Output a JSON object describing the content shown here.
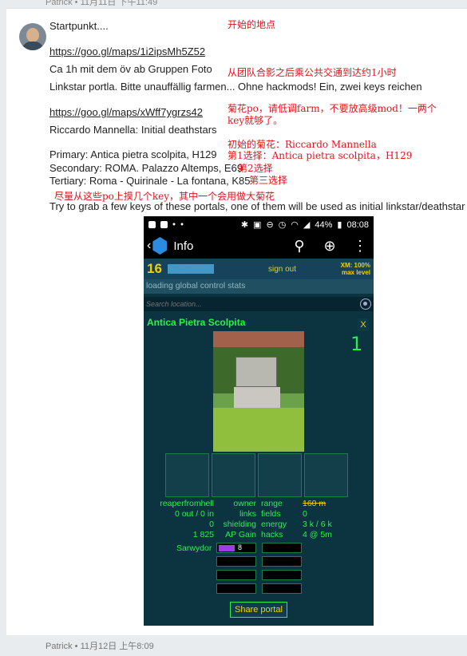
{
  "post": {
    "header_meta": "Patrick • 11月11日 下午11:49",
    "lines": [
      "Startpunkt....",
      "https://goo.gl/maps/1i2ipsMh5Z52",
      "Ca 1h mit dem öv ab Gruppen Foto",
      "Linkstar portla. Bitte unauffällig farmen... Ohne hackmods! Ein, zwei keys reichen",
      "https://goo.gl/maps/xWff7ygrzs42",
      "Riccardo Mannella: Initial deathstars",
      "Primary: Antica pietra scolpita, H129",
      "Secondary: ROMA. Palazzo Altemps, E69",
      "Tertiary: Roma - Quirinale - La fontana, K85",
      "Try to grab a few keys of these portals, one of them will be used as initial linkstar/deathstar"
    ],
    "notes": [
      "开始的地点",
      "从团队合影之后乘公共交通到达约1小时",
      "菊花po，请低调farm，不要放高级mod！一两个",
      "key就够了。",
      "初始的菊花：Riccardo Mannella",
      "第1选择：Antica pietra scolpita，H129",
      "第2选择",
      "第三选择",
      "尽量从这些po上摸几个key，其中一个会用做大菊花"
    ],
    "footer_meta": "Patrick • 11月12日 上午8:09"
  },
  "phone": {
    "status": {
      "battery": "44%",
      "time": "08:08"
    },
    "appbar": {
      "back": "‹",
      "title": "Info"
    },
    "agent": {
      "level": "16",
      "name": "hidden",
      "sign_out": "sign out",
      "xm_line1": "XM: 100%",
      "xm_line2": "max level"
    },
    "loading": "loading global control stats",
    "search_placeholder": "Search location...",
    "portal": {
      "name": "Antica Pietra Scolpita",
      "close": "X",
      "number": "1",
      "owner_name": "reaperfromhell",
      "out_in": "0 out / 0 in",
      "shielding_val": "0",
      "ap_val": "1 825",
      "lbl_owner": "owner",
      "lbl_links": "links",
      "lbl_shielding": "shielding",
      "lbl_ap": "AP Gain",
      "lbl_range": "range",
      "lbl_fields": "fields",
      "lbl_energy": "energy",
      "lbl_hacks": "hacks",
      "range_val": "160 m",
      "fields_val": "0",
      "energy_val": "3 k / 6 k",
      "hacks_val": "4 @ 5m",
      "reso_owner": "Sarwydor",
      "reso_level": "8",
      "share": "Share portal"
    }
  },
  "colors": {
    "accent_green": "#2bef4f",
    "ingress_yellow": "#f0d000",
    "note_red": "#e0141e"
  }
}
